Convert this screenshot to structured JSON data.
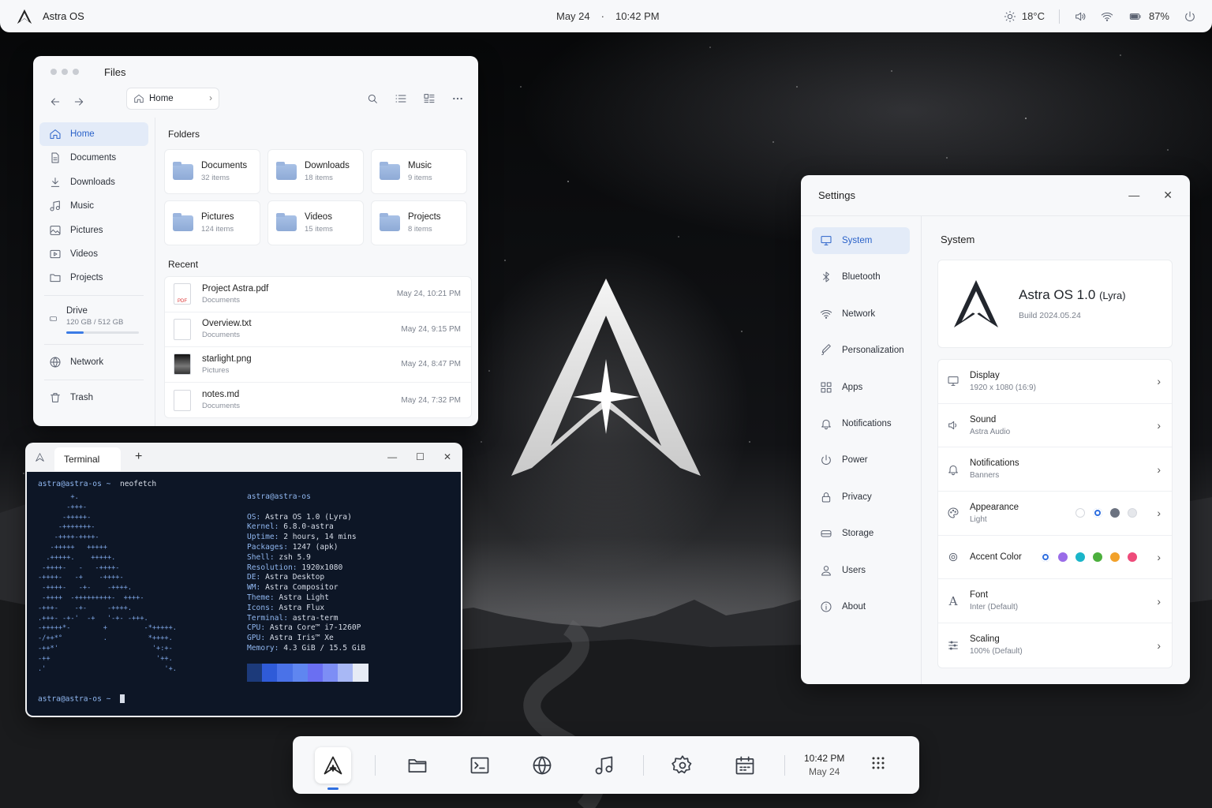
{
  "topbar": {
    "os_name": "Astra OS",
    "date": "May 24",
    "separator": "·",
    "time": "10:42 PM",
    "weather": "18°C",
    "battery": "87%",
    "icons": [
      "astra-logo-icon",
      "sun-icon",
      "volume-icon",
      "wifi-icon",
      "battery-icon",
      "power-icon"
    ]
  },
  "files": {
    "title": "Files",
    "address": "Home",
    "sidebar": [
      {
        "label": "Home",
        "icon": "home-icon",
        "active": true
      },
      {
        "label": "Documents",
        "icon": "document-icon"
      },
      {
        "label": "Downloads",
        "icon": "download-icon"
      },
      {
        "label": "Music",
        "icon": "music-icon"
      },
      {
        "label": "Pictures",
        "icon": "image-icon"
      },
      {
        "label": "Videos",
        "icon": "video-icon"
      },
      {
        "label": "Projects",
        "icon": "folder-icon"
      }
    ],
    "drive": {
      "label": "Drive",
      "usage": "120 GB / 512 GB",
      "fraction": 0.234
    },
    "network_label": "Network",
    "trash_label": "Trash",
    "folders_heading": "Folders",
    "folders": [
      {
        "name": "Documents",
        "count": "32 items"
      },
      {
        "name": "Downloads",
        "count": "18 items"
      },
      {
        "name": "Music",
        "count": "9 items"
      },
      {
        "name": "Pictures",
        "count": "124 items"
      },
      {
        "name": "Videos",
        "count": "15 items"
      },
      {
        "name": "Projects",
        "count": "8 items"
      }
    ],
    "recent_heading": "Recent",
    "recent": [
      {
        "name": "Project Astra.pdf",
        "location": "Documents",
        "date": "May 24, 10:21 PM",
        "type": "pdf"
      },
      {
        "name": "Overview.txt",
        "location": "Documents",
        "date": "May 24, 9:15 PM",
        "type": "txt"
      },
      {
        "name": "starlight.png",
        "location": "Pictures",
        "date": "May 24, 8:47 PM",
        "type": "img"
      },
      {
        "name": "notes.md",
        "location": "Documents",
        "date": "May 24, 7:32 PM",
        "type": "md"
      }
    ]
  },
  "terminal": {
    "tab_label": "Terminal",
    "new_tab": "+",
    "prompt": "astra@astra-os ~",
    "command": "neofetch",
    "user_host": "astra@astra-os",
    "info": [
      {
        "k": "OS",
        "v": "Astra OS 1.0 (Lyra)"
      },
      {
        "k": "Kernel",
        "v": "6.8.0-astra"
      },
      {
        "k": "Uptime",
        "v": "2 hours, 14 mins"
      },
      {
        "k": "Packages",
        "v": "1247 (apk)"
      },
      {
        "k": "Shell",
        "v": "zsh 5.9"
      },
      {
        "k": "Resolution",
        "v": "1920x1080"
      },
      {
        "k": "DE",
        "v": "Astra Desktop"
      },
      {
        "k": "WM",
        "v": "Astra Compositor"
      },
      {
        "k": "Theme",
        "v": "Astra Light"
      },
      {
        "k": "Icons",
        "v": "Astra Flux"
      },
      {
        "k": "Terminal",
        "v": "astra-term"
      },
      {
        "k": "CPU",
        "v": "Astra Core™ i7-1260P"
      },
      {
        "k": "GPU",
        "v": "Astra Iris™ Xe"
      },
      {
        "k": "Memory",
        "v": "4.3 GiB / 15.5 GiB"
      }
    ],
    "palette": [
      "#1c3a7a",
      "#2f5bd8",
      "#4a72e8",
      "#5f86f0",
      "#6a6ff2",
      "#7d8ef5",
      "#a8b8f5",
      "#e6ebf5"
    ],
    "ascii": "        +.\n       -+++-\n      -+++++-\n     -+++++++-\n    -++++-++++-\n   -+++++   +++++\n  .+++++.    +++++.\n -++++-   -   -++++-\n-++++-   -+    -++++-\n -++++-   -+-    -++++.\n -++++  -+++++++++-  ++++-\n-+++-    -+-     -++++.\n.+++- -+-'  -+   '-+- -+++.\n-+++++*-        +         -*+++++.\n-/++*°          .          *++++.\n-++*'                       '+:+-\n-++                          '++.\n.'                             '+.",
    "final_prompt": "astra@astra-os ~"
  },
  "settings": {
    "title": "Settings",
    "nav": [
      {
        "label": "System",
        "icon": "monitor-icon",
        "active": true
      },
      {
        "label": "Bluetooth",
        "icon": "bluetooth-icon"
      },
      {
        "label": "Network",
        "icon": "wifi-icon"
      },
      {
        "label": "Personalization",
        "icon": "brush-icon"
      },
      {
        "label": "Apps",
        "icon": "apps-grid-icon"
      },
      {
        "label": "Notifications",
        "icon": "bell-icon"
      },
      {
        "label": "Power",
        "icon": "power-icon"
      },
      {
        "label": "Privacy",
        "icon": "lock-icon"
      },
      {
        "label": "Storage",
        "icon": "storage-icon"
      },
      {
        "label": "Users",
        "icon": "user-icon"
      },
      {
        "label": "About",
        "icon": "info-icon"
      }
    ],
    "section_title": "System",
    "os_name": "Astra OS 1.0",
    "os_codename": "(Lyra)",
    "build": "Build 2024.05.24",
    "rows": [
      {
        "title": "Display",
        "sub": "1920 x 1080 (16:9)",
        "icon": "monitor-icon"
      },
      {
        "title": "Sound",
        "sub": "Astra Audio",
        "icon": "volume-icon"
      },
      {
        "title": "Notifications",
        "sub": "Banners",
        "icon": "bell-icon"
      },
      {
        "title": "Appearance",
        "sub": "Light",
        "icon": "palette-icon",
        "swatches": [
          "#ffffff",
          "#2f6fe0",
          "#6b7280",
          "#e5e7eb"
        ],
        "selected": 1
      },
      {
        "title": "Accent Color",
        "sub": "",
        "icon": "accent-icon",
        "swatches": [
          "#2f6fe0",
          "#9a6ce8",
          "#1ab5c9",
          "#4caf3d",
          "#f2a12a",
          "#ee4b7a"
        ],
        "selected": 0
      },
      {
        "title": "Font",
        "sub": "Inter (Default)",
        "icon": "font-icon"
      },
      {
        "title": "Scaling",
        "sub": "100% (Default)",
        "icon": "sliders-icon"
      }
    ]
  },
  "dock": {
    "apps": [
      "astra-launcher",
      "files",
      "terminal",
      "browser",
      "music",
      "settings",
      "calendar"
    ],
    "time": "10:42 PM",
    "date": "May 24"
  }
}
